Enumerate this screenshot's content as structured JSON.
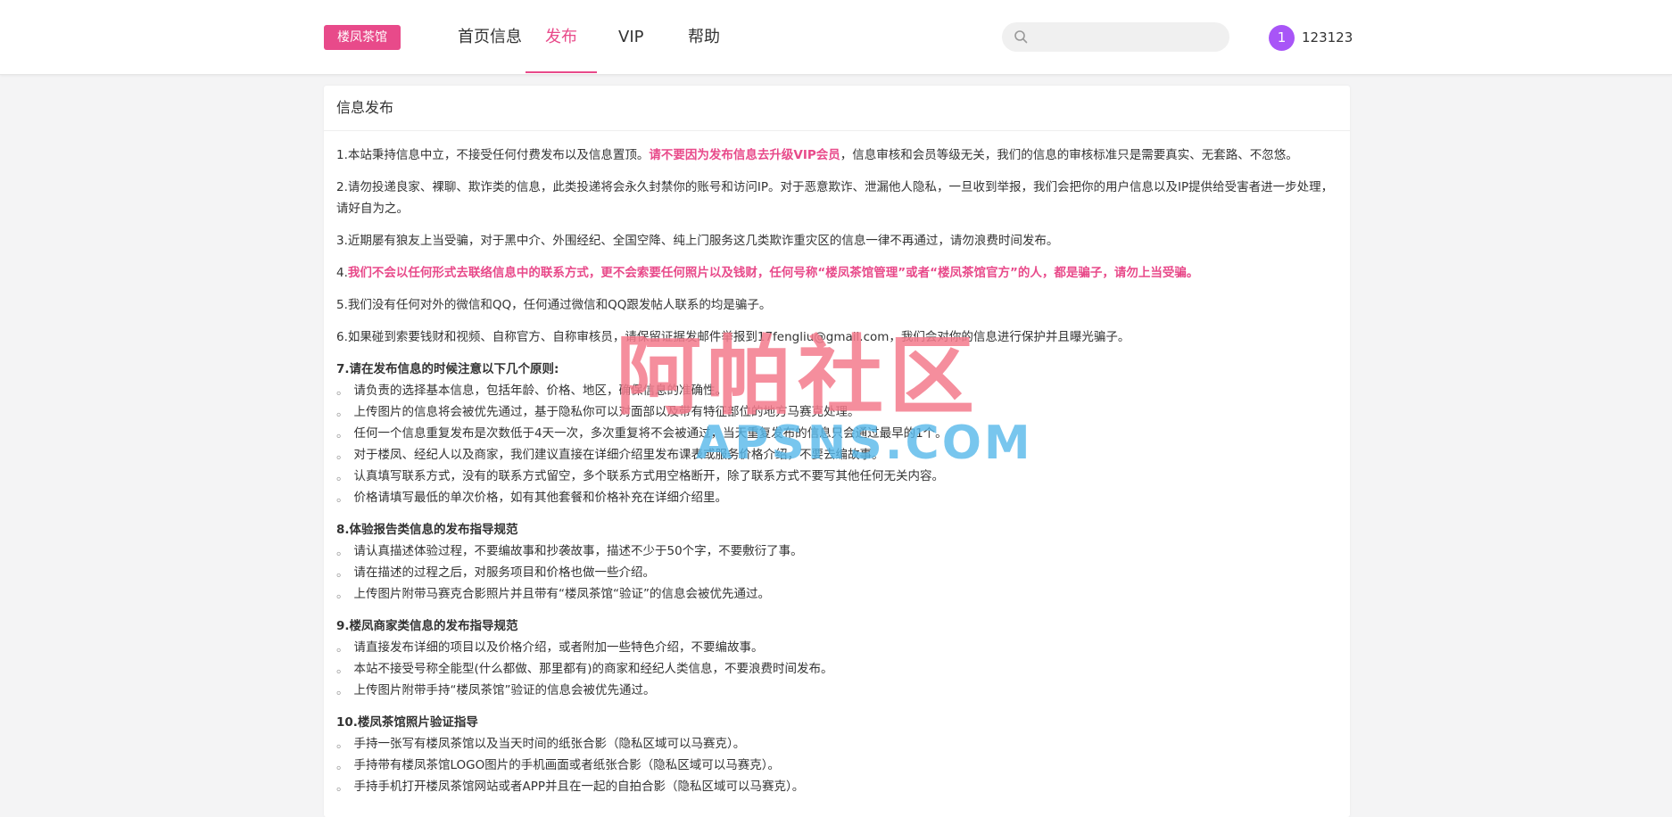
{
  "header": {
    "logo": "楼凤茶馆",
    "nav": [
      {
        "label": "首页信息"
      },
      {
        "label": "发布"
      },
      {
        "label": "VIP"
      },
      {
        "label": "帮助"
      }
    ],
    "search": {
      "placeholder": ""
    },
    "user": {
      "avatar_text": "1",
      "name": "123123"
    }
  },
  "card": {
    "title": "信息发布",
    "p1": {
      "a": "1.本站秉持信息中立，不接受任何付费发布以及信息置顶。",
      "b": "请不要因为发布信息去升级VIP会员",
      "c": "，信息审核和会员等级无关，我们的信息的审核标准只是需要真实、无套路、不忽悠。"
    },
    "p2": "2.请勿投递良家、裸聊、欺诈类的信息，此类投递将会永久封禁你的账号和访问IP。对于恶意欺诈、泄漏他人隐私，一旦收到举报，我们会把你的用户信息以及IP提供给受害者进一步处理，请好自为之。",
    "p3": "3.近期屡有狼友上当受骗，对于黑中介、外围经纪、全国空降、纯上门服务这几类欺诈重灾区的信息一律不再通过，请勿浪费时间发布。",
    "p4": {
      "a": "4.",
      "b": "我们不会以任何形式去联络信息中的联系方式，更不会索要任何照片以及钱财，任何号称“楼凤茶馆管理”或者“楼凤茶馆官方”的人，都是骗子，请勿上当受骗。"
    },
    "p5": "5.我们没有任何对外的微信和QQ，任何通过微信和QQ跟发帖人联系的均是骗子。",
    "p6": "6.如果碰到索要钱财和视频、自称官方、自称审核员，请保留证据发邮件举报到17fengliu@gmail.com，我们会对你的信息进行保护并且曝光骗子。",
    "s7": {
      "title": "7.请在发布信息的时候注意以下几个原则:",
      "items": [
        "请负责的选择基本信息，包括年龄、价格、地区，确保信息的准确性。",
        "上传图片的信息将会被优先通过，基于隐私你可以对面部以及带有特征部位的地方马赛克处理。",
        "任何一个信息重复发布是次数低于4天一次，多次重复将不会被通过，当天重复发布的信息只会通过最早的1个。",
        "对于楼凤、经纪人以及商家，我们建议直接在详细介绍里发布课表或服务价格介绍，不要去编故事。",
        "认真填写联系方式，没有的联系方式留空，多个联系方式用空格断开，除了联系方式不要写其他任何无关内容。",
        "价格请填写最低的单次价格，如有其他套餐和价格补充在详细介绍里。"
      ]
    },
    "s8": {
      "title": "8.体验报告类信息的发布指导规范",
      "items": [
        "请认真描述体验过程，不要编故事和抄袭故事，描述不少于50个字，不要敷衍了事。",
        "请在描述的过程之后，对服务项目和价格也做一些介绍。",
        "上传图片附带马赛克合影照片并且带有“楼凤茶馆“验证”的信息会被优先通过。"
      ]
    },
    "s9": {
      "title": "9.楼凤商家类信息的发布指导规范",
      "items": [
        "请直接发布详细的项目以及价格介绍，或者附加一些特色介绍，不要编故事。",
        "本站不接受号称全能型(什么都做、那里都有)的商家和经纪人类信息，不要浪费时间发布。",
        "上传图片附带手持“楼凤茶馆”验证的信息会被优先通过。"
      ]
    },
    "s10": {
      "title": "10.楼凤茶馆照片验证指导",
      "items": [
        "手持一张写有楼凤茶馆以及当天时间的纸张合影（隐私区域可以马赛克）。",
        "手持带有楼凤茶馆LOGO图片的手机画面或者纸张合影（隐私区域可以马赛克）。",
        "手持手机打开楼凤茶馆网站或者APP并且在一起的自拍合影（隐私区域可以马赛克）。"
      ]
    }
  },
  "watermark": {
    "cn": "阿帕社区",
    "en": "APSNS.COM"
  }
}
